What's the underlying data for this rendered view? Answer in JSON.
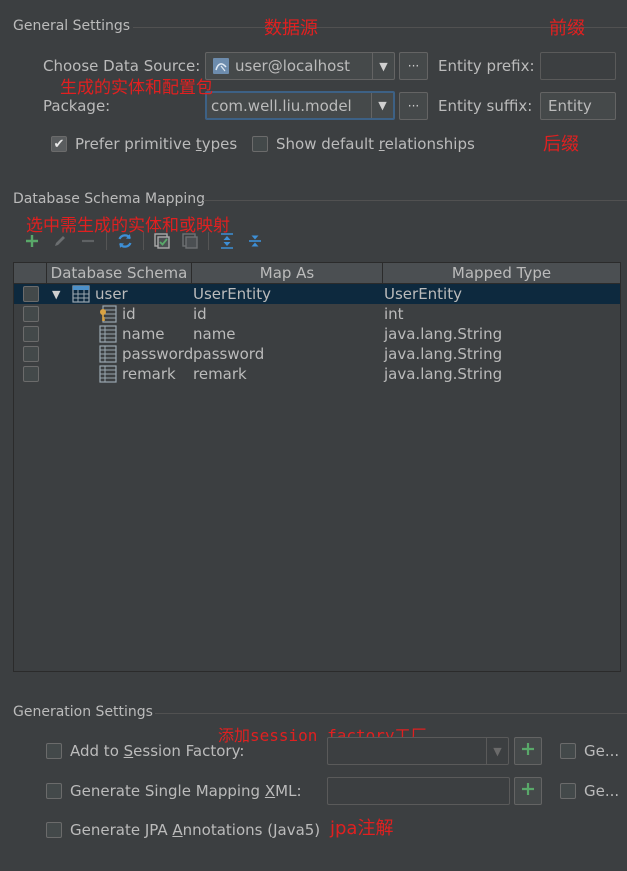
{
  "general": {
    "title": "General Settings",
    "choose_ds_label": "Choose Data Source:",
    "data_source_value": "user@localhost",
    "package_label": "Package:",
    "package_value": "com.well.liu.model",
    "dots_label": "···",
    "entity_prefix_label": "Entity prefix:",
    "entity_prefix_value": "",
    "entity_suffix_label": "Entity suffix:",
    "entity_suffix_value": "Entity",
    "prefer_primitive_label": "Prefer primitive types",
    "prefer_primitive_checked": true,
    "show_default_rel_label": "Show default relationships",
    "show_default_rel_checked": false
  },
  "mapping": {
    "title": "Database Schema Mapping",
    "columns": [
      "Database Schema",
      "Map As",
      "Mapped Type"
    ],
    "rows": [
      {
        "schema": "user",
        "map_as": "UserEntity",
        "type": "UserEntity",
        "kind": "table",
        "expanded": true
      },
      {
        "schema": "id",
        "map_as": "id",
        "type": "int",
        "kind": "key-column"
      },
      {
        "schema": "name",
        "map_as": "name",
        "type": "java.lang.String",
        "kind": "column"
      },
      {
        "schema": "password",
        "map_as": "password",
        "type": "java.lang.String",
        "kind": "column"
      },
      {
        "schema": "remark",
        "map_as": "remark",
        "type": "java.lang.String",
        "kind": "column"
      }
    ]
  },
  "generation": {
    "title": "Generation Settings",
    "add_session_label_pre": "Add to ",
    "add_session_label_u": "S",
    "add_session_label_post": "ession Factory:",
    "single_xml_label_pre": "Generate Single Mapping ",
    "single_xml_label_u": "X",
    "single_xml_label_post": "ML:",
    "jpa_label_pre": "Generate JPA ",
    "jpa_label_u": "A",
    "jpa_label_post": "nnotations (Java5)",
    "ge_label_1": "Ge...",
    "ge_label_2": "Ge..."
  },
  "annotations": {
    "data_source": "数据源",
    "prefix": "前缀",
    "entity_package": "生成的实体和配置包",
    "suffix": "后缀",
    "select_entities": "选中需生成的实体和或映射",
    "session_factory": "添加session factory工厂",
    "jpa": "jpa注解"
  },
  "colors": {
    "background": "#3c3f41",
    "annotation_red": "#e02020",
    "selection": "#0d293e",
    "add_green": "#59a869",
    "refresh_blue": "#3d8fd6"
  }
}
